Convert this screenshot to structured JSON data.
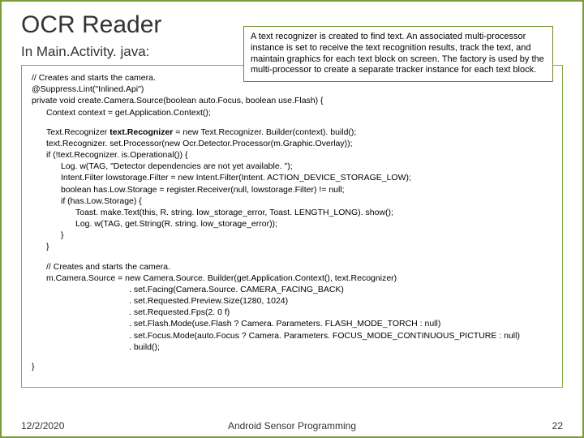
{
  "title": "OCR Reader",
  "subtitle": "In Main.Activity. java:",
  "callout": "A text recognizer is created to find text.  An associated multi-processor instance is set to receive the text recognition results, track the text, and maintain graphics for each text block on screen.  The factory is used by the multi-processor to create a separate tracker instance for each text block.",
  "code": {
    "block1": {
      "l1": "// Creates and starts the camera.",
      "l2": "@Suppress.Lint(\"Inlined.Api\")",
      "l3": "private void create.Camera.Source(boolean auto.Focus, boolean use.Flash) {",
      "l4": "Context context = get.Application.Context();"
    },
    "block2": {
      "l1_pre": "Text.Recognizer ",
      "l1_bold": "text.Recognizer",
      "l1_post": " = new Text.Recognizer. Builder(context). build();",
      "l2": "text.Recognizer. set.Processor(new Ocr.Detector.Processor(m.Graphic.Overlay));",
      "l3": "if (!text.Recognizer. is.Operational()) {",
      "l4": "Log. w(TAG, \"Detector dependencies are not yet available. \");",
      "l5": "Intent.Filter lowstorage.Filter = new Intent.Filter(Intent. ACTION_DEVICE_STORAGE_LOW);",
      "l6": "boolean has.Low.Storage = register.Receiver(null, lowstorage.Filter) != null;",
      "l7": "if (has.Low.Storage) {",
      "l8": "Toast. make.Text(this, R. string. low_storage_error, Toast. LENGTH_LONG). show();",
      "l9": "Log. w(TAG, get.String(R. string. low_storage_error));",
      "l10": "}",
      "l11": "}"
    },
    "block3": {
      "l1": "// Creates and starts the camera.",
      "l2": "m.Camera.Source = new Camera.Source. Builder(get.Application.Context(), text.Recognizer)",
      "l3": ". set.Facing(Camera.Source. CAMERA_FACING_BACK)",
      "l4": ". set.Requested.Preview.Size(1280, 1024)",
      "l5": ". set.Requested.Fps(2. 0 f)",
      "l6": ". set.Flash.Mode(use.Flash ? Camera. Parameters. FLASH_MODE_TORCH : null)",
      "l7": ". set.Focus.Mode(auto.Focus ? Camera. Parameters. FOCUS_MODE_CONTINUOUS_PICTURE : null)",
      "l8": ". build();"
    },
    "close": "}"
  },
  "footer": {
    "date": "12/2/2020",
    "center": "Android Sensor Programming",
    "page": "22"
  }
}
